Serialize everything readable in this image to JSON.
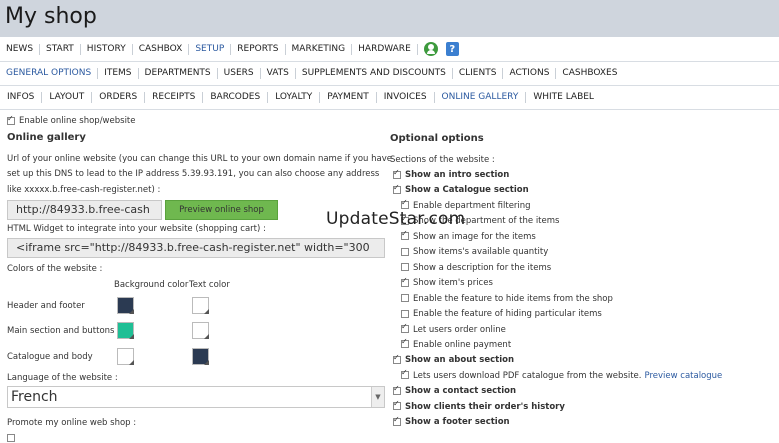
{
  "app": {
    "title": "My shop"
  },
  "nav_main": {
    "items": [
      "NEWS",
      "START",
      "HISTORY",
      "CASHBOX",
      "SETUP",
      "REPORTS",
      "MARKETING",
      "HARDWARE"
    ],
    "active": "SETUP",
    "icons": [
      "user-icon",
      "help-icon"
    ]
  },
  "nav_setup": {
    "items": [
      "GENERAL OPTIONS",
      "ITEMS",
      "DEPARTMENTS",
      "USERS",
      "VATS",
      "SUPPLEMENTS AND DISCOUNTS",
      "CLIENTS",
      "ACTIONS",
      "CASHBOXES"
    ],
    "active": "GENERAL OPTIONS"
  },
  "nav_general": {
    "items": [
      "INFOS",
      "LAYOUT",
      "ORDERS",
      "RECEIPTS",
      "BARCODES",
      "LOYALTY",
      "PAYMENT",
      "INVOICES",
      "ONLINE GALLERY",
      "WHITE LABEL"
    ],
    "active": "ONLINE GALLERY"
  },
  "gallery": {
    "enable_label": "Enable online shop/website",
    "enable_checked": true,
    "heading": "Online gallery",
    "url_desc_1": "Url of your online website (you can change this URL to your own domain name if you have",
    "url_desc_2": "set up this DNS to lead to the IP address 5.39.93.191, you can also choose any address",
    "url_desc_3": "like xxxxx.b.free-cash-register.net) :",
    "url_value": "http://84933.b.free-cash",
    "preview_button": "Preview online shop",
    "widget_label": "HTML Widget to integrate into your website (shopping cart) :",
    "widget_value": "<iframe src=\"http://84933.b.free-cash-register.net\" width=\"300",
    "colors_label": "Colors of the website :",
    "bg_color_header": "Background color",
    "text_color_header": "Text color",
    "color_rows": [
      {
        "label": "Header and footer",
        "bg": "#2b3a52",
        "text": "#ffffff"
      },
      {
        "label": "Main section and buttons",
        "bg": "#1fbf95",
        "text": "#ffffff"
      },
      {
        "label": "Catalogue and body",
        "bg": "#ffffff",
        "text": "#2b3a52"
      }
    ],
    "language_label": "Language of the website :",
    "language_value": "French",
    "promote_label": "Promote my online web shop :"
  },
  "optional": {
    "heading": "Optional options",
    "sections_label": "Sections of the website :",
    "items": [
      {
        "label": "Show an intro section",
        "checked": true,
        "bold": true,
        "indent": 0
      },
      {
        "label": "Show a Catalogue section",
        "checked": true,
        "bold": true,
        "indent": 0
      },
      {
        "label": "Enable department filtering",
        "checked": true,
        "bold": false,
        "indent": 1
      },
      {
        "label": "Show the department of the items",
        "checked": true,
        "bold": false,
        "indent": 1
      },
      {
        "label": "Show an image for the items",
        "checked": true,
        "bold": false,
        "indent": 1
      },
      {
        "label": "Show items's available quantity",
        "checked": false,
        "bold": false,
        "indent": 1
      },
      {
        "label": "Show a description for the items",
        "checked": false,
        "bold": false,
        "indent": 1
      },
      {
        "label": "Show item's prices",
        "checked": true,
        "bold": false,
        "indent": 1
      },
      {
        "label": "Enable the feature to hide items from the shop",
        "checked": false,
        "bold": false,
        "indent": 1
      },
      {
        "label": "Enable the feature of hiding particular items",
        "checked": false,
        "bold": false,
        "indent": 1
      },
      {
        "label": "Let users order online",
        "checked": true,
        "bold": false,
        "indent": 1
      },
      {
        "label": "Enable online payment",
        "checked": true,
        "bold": false,
        "indent": 1
      },
      {
        "label": "Show an about section",
        "checked": true,
        "bold": true,
        "indent": 0
      },
      {
        "label": "Lets users download PDF catalogue from the website.",
        "link": "Preview catalogue",
        "checked": true,
        "bold": false,
        "indent": 1
      },
      {
        "label": "Show a contact section",
        "checked": true,
        "bold": true,
        "indent": 0
      },
      {
        "label": "Show clients their order's history",
        "checked": true,
        "bold": true,
        "indent": 0
      },
      {
        "label": "Show a footer section",
        "checked": true,
        "bold": true,
        "indent": 0
      }
    ]
  },
  "watermark": "UpdateStar.com"
}
